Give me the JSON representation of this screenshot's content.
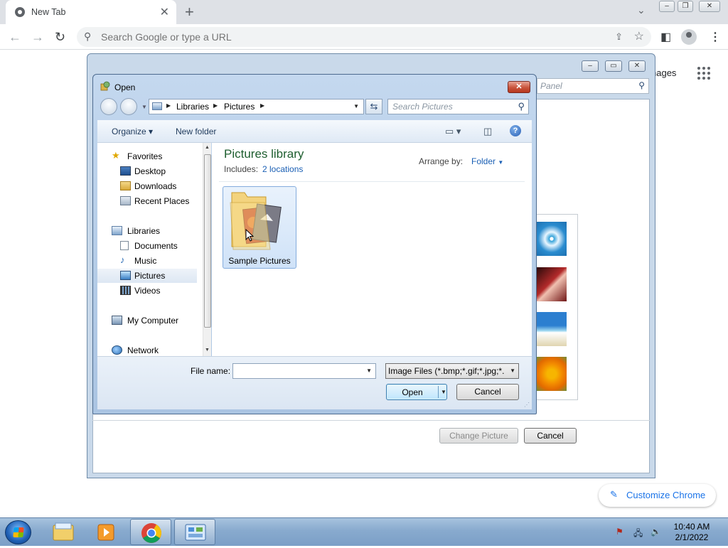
{
  "browser": {
    "tab_title": "New Tab",
    "tab_close": "✕",
    "new_tab": "+",
    "omnibox_placeholder": "Search Google or type a URL",
    "images_link": "nages",
    "customize_label": "Customize Chrome"
  },
  "background_dialog": {
    "panel_search_placeholder": "Panel",
    "change_picture_label": "Change Picture",
    "cancel_label": "Cancel"
  },
  "open_dialog": {
    "title": "Open",
    "close_glyph": "✕",
    "breadcrumb": [
      "Libraries",
      "Pictures"
    ],
    "search_placeholder": "Search Pictures",
    "organize_label": "Organize ▾",
    "new_folder_label": "New folder",
    "nav_pane": {
      "favorites_label": "Favorites",
      "favorites": [
        "Desktop",
        "Downloads",
        "Recent Places"
      ],
      "libraries_label": "Libraries",
      "libraries": [
        "Documents",
        "Music",
        "Pictures",
        "Videos"
      ],
      "computer_label": "My Computer",
      "network_label": "Network",
      "selected": "Pictures"
    },
    "library_title": "Pictures library",
    "includes_label": "Includes:",
    "includes_link": "2 locations",
    "arrange_label": "Arrange by:",
    "arrange_value": "Folder",
    "items": [
      {
        "name": "Sample Pictures",
        "type": "folder",
        "selected": true
      }
    ],
    "file_name_label": "File name:",
    "file_name_value": "",
    "filter_value": "Image Files (*.bmp;*.gif;*.jpg;*.",
    "open_label": "Open",
    "cancel_label": "Cancel"
  },
  "taskbar": {
    "clock_time": "10:40 AM",
    "clock_date": "2/1/2022",
    "pinned": [
      "windows-explorer",
      "media-player",
      "google-chrome",
      "control-panel"
    ],
    "active": "google-chrome"
  },
  "colors": {
    "library_title": "#1e5e2f",
    "link_blue": "#1a5fb4",
    "chrome_accent": "#1a73e8"
  }
}
